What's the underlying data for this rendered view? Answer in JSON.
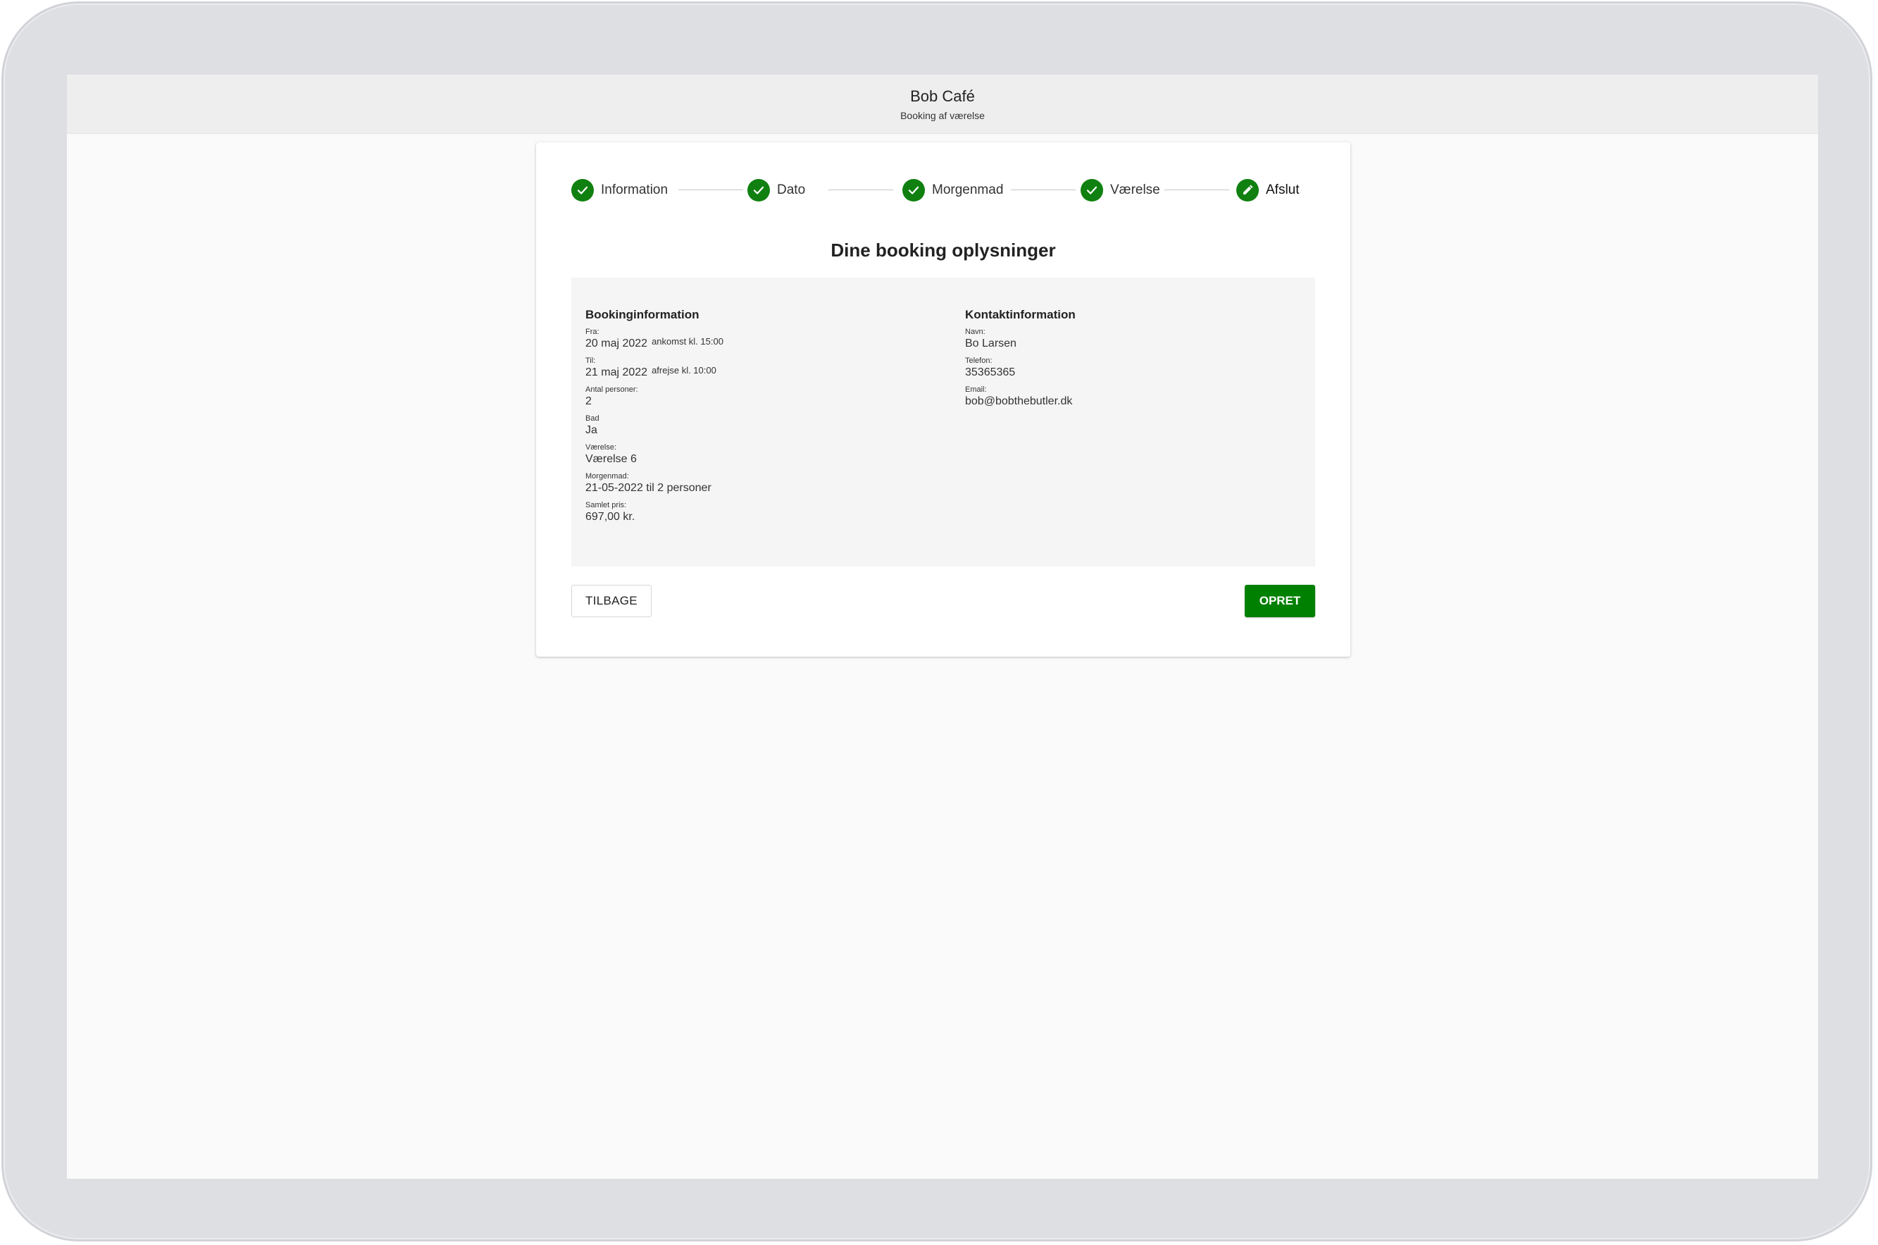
{
  "header": {
    "title": "Bob Café",
    "subtitle": "Booking af værelse"
  },
  "stepper": {
    "steps": [
      {
        "label": "Information",
        "state": "completed",
        "icon": "check-icon"
      },
      {
        "label": "Dato",
        "state": "completed",
        "icon": "check-icon"
      },
      {
        "label": "Morgenmad",
        "state": "completed",
        "icon": "check-icon"
      },
      {
        "label": "Værelse",
        "state": "completed",
        "icon": "check-icon"
      },
      {
        "label": "Afslut",
        "state": "active",
        "icon": "pencil-icon"
      }
    ]
  },
  "main": {
    "title": "Dine booking oplysninger"
  },
  "booking": {
    "heading": "Bookinginformation",
    "from_label": "Fra:",
    "from_value": "20 maj 2022",
    "from_extra": "ankomst kl. 15:00",
    "to_label": "Til:",
    "to_value": "21 maj 2022",
    "to_extra": "afrejse kl. 10:00",
    "persons_label": "Antal personer:",
    "persons_value": "2",
    "bath_label": "Bad",
    "bath_value": "Ja",
    "room_label": "Værelse:",
    "room_value": "Værelse 6",
    "breakfast_label": "Morgenmad:",
    "breakfast_value": "21-05-2022 til 2 personer",
    "total_label": "Samlet pris:",
    "total_value": "697,00 kr."
  },
  "contact": {
    "heading": "Kontaktinformation",
    "name_label": "Navn:",
    "name_value": "Bo Larsen",
    "phone_label": "Telefon:",
    "phone_value": "35365365",
    "email_label": "Email:",
    "email_value": "bob@bobthebutler.dk"
  },
  "actions": {
    "back_label": "TILBAGE",
    "create_label": "OPRET"
  },
  "colors": {
    "accent": "#008000",
    "header_bg": "#eeeeee",
    "summary_bg": "#f5f5f5"
  }
}
